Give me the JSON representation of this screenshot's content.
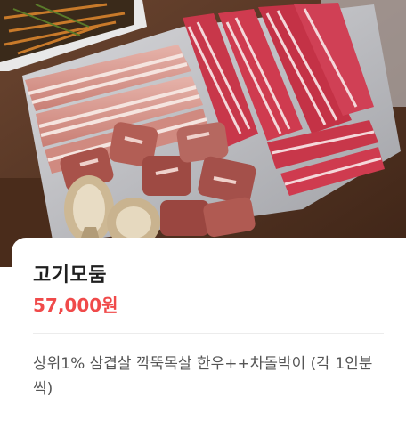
{
  "menu_item": {
    "name": "고기모둠",
    "price": "57,000원",
    "description": "상위1% 삼겹살 깍뚝목살 한우++차돌박이 (각 1인분씩)"
  },
  "colors": {
    "price_accent": "#f04a4a",
    "title_text": "#1f1f1f",
    "description_text": "#555555",
    "divider": "#ececec"
  }
}
